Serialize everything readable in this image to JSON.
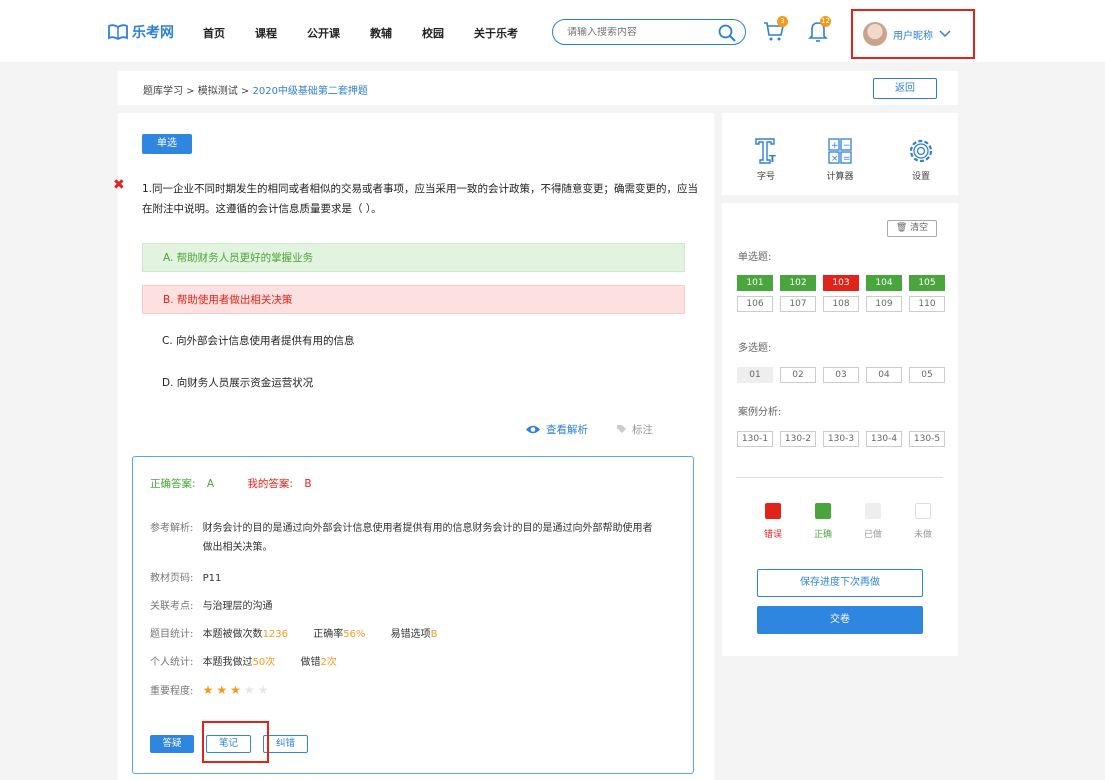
{
  "header": {
    "logo_text": "乐考网",
    "nav": [
      "首页",
      "课程",
      "公开课",
      "教辅",
      "校园",
      "关于乐考"
    ],
    "search_placeholder": "请输入搜索内容",
    "cart_badge": "3",
    "bell_badge": "12",
    "user_name": "用户昵称"
  },
  "breadcrumb": {
    "path": "题库学习 > 模拟测试 > ",
    "current": "2020中级基础第二套押题",
    "back_label": "返回"
  },
  "question": {
    "type_label": "单选",
    "text": "1.同一企业不同时期发生的相同或者相似的交易或者事项，应当采用一致的会计政策，不得随意变更；确需变更的，应当在附注中说明。这遵循的会计信息质量要求是（ ）。",
    "options": [
      "A.  帮助财务人员更好的掌握业务",
      "B.  帮助使用者做出相关决策",
      "C.  向外部会计信息使用者提供有用的信息",
      "D.  向财务人员展示资金运营状况"
    ],
    "view_analysis": "查看解析",
    "mark_label": "标注"
  },
  "analysis": {
    "correct_label": "正确答案:",
    "correct_value": "A",
    "my_label": "我的答案:",
    "my_value": "B",
    "ref_label": "参考解析:",
    "ref_text": "财务会计的目的是通过向外部会计信息使用者提供有用的信息财务会计的目的是通过向外部帮助使用者做出相关决策。",
    "page_label": "教材页码:",
    "page_value": "P11",
    "point_label": "关联考点:",
    "point_value": "与治理层的沟通",
    "stats_label": "题目统计:",
    "stats_done": "本题被做次数",
    "stats_done_val": "1236",
    "stats_rate": "正确率",
    "stats_rate_val": "56%",
    "stats_easy": "易错选项",
    "stats_easy_val": "B",
    "personal_label": "个人统计:",
    "personal_done": "本题我做过",
    "personal_done_val": "50次",
    "personal_wrong": "做错",
    "personal_wrong_val": "2次",
    "importance_label": "重要程度:",
    "importance": 3,
    "importance_max": 5,
    "btn_ask": "答疑",
    "btn_note": "笔记",
    "btn_error": "纠错"
  },
  "tools": {
    "font": "字号",
    "calculator": "计算器",
    "settings": "设置"
  },
  "sheet": {
    "clear_label": "清空",
    "single_title": "单选题:",
    "single": [
      "101",
      "102",
      "103",
      "104",
      "105",
      "106",
      "107",
      "108",
      "109",
      "110"
    ],
    "multi_title": "多选题:",
    "multi": [
      "01",
      "02",
      "03",
      "04",
      "05"
    ],
    "case_title": "案例分析:",
    "case": [
      "130-1",
      "130-2",
      "130-3",
      "130-4",
      "130-5"
    ],
    "legend": [
      "错误",
      "正确",
      "已做",
      "未做"
    ],
    "save_label": "保存进度下次再做",
    "submit_label": "交卷"
  },
  "colors": {
    "accent": "#2f86e0",
    "correct": "#48a63c",
    "wrong": "#e2231a",
    "done": "#eeeeee"
  }
}
